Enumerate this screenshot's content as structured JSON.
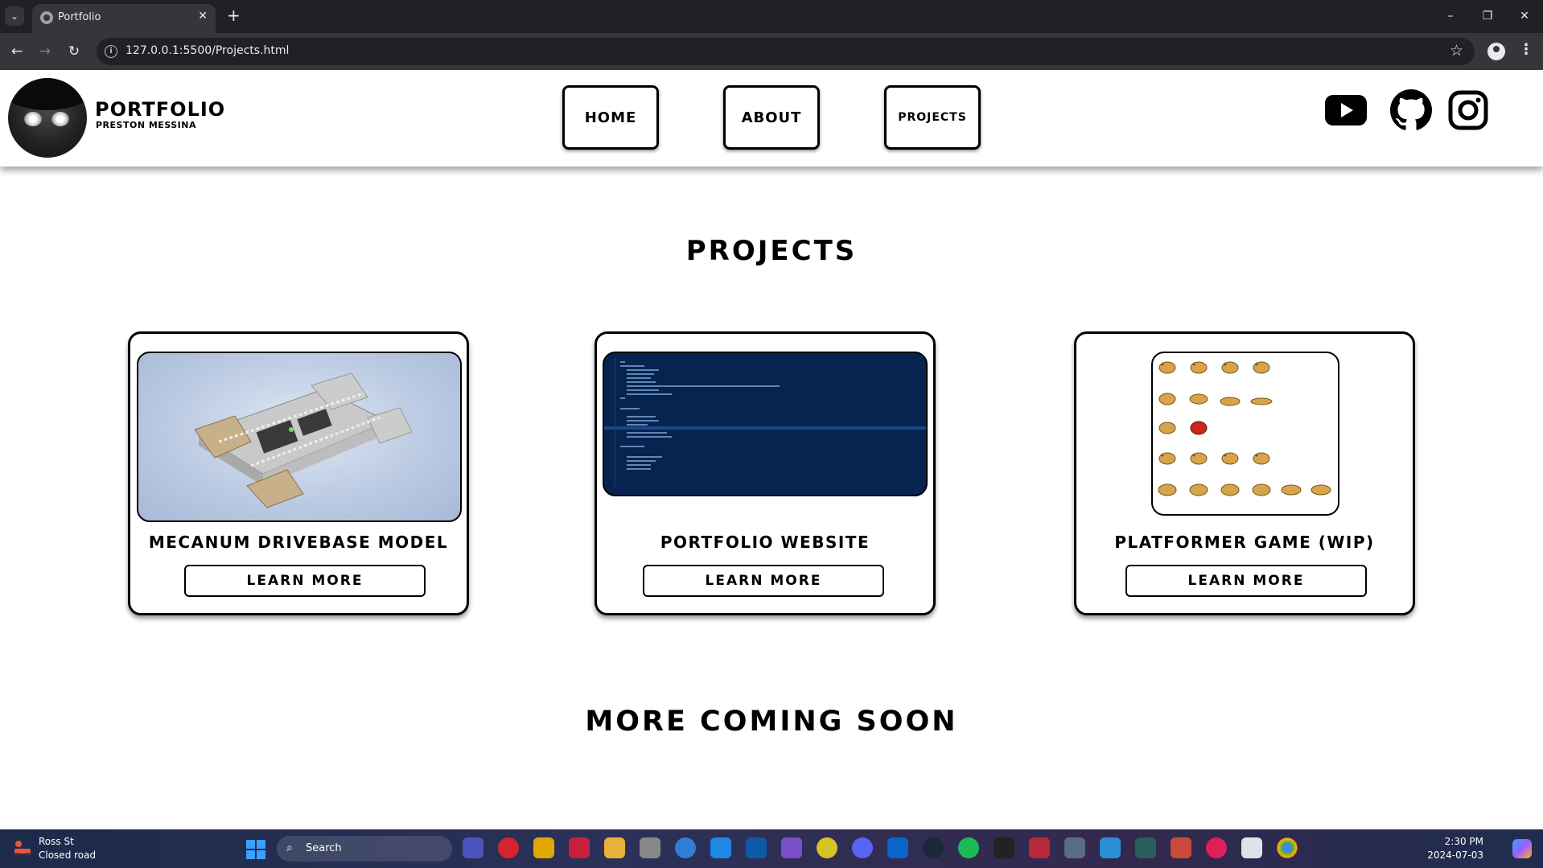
{
  "browser": {
    "tab_title": "Portfolio",
    "tab_close": "✕",
    "new_tab": "+",
    "url": "127.0.0.1:5500/Projects.html",
    "window_controls": [
      "–",
      "❐",
      "✕"
    ]
  },
  "header": {
    "brand_title": "PORTFOLIO",
    "brand_subtitle": "PRESTON MESSINA",
    "nav": [
      {
        "label": "HOME"
      },
      {
        "label": "ABOUT"
      },
      {
        "label": "PROJECTS"
      }
    ],
    "social": [
      "youtube-icon",
      "github-icon",
      "instagram-icon"
    ]
  },
  "main": {
    "heading": "PROJECTS",
    "projects": [
      {
        "title": "MECANUM DRIVEBASE MODEL",
        "button": "LEARN MORE",
        "image": "cad-model-render"
      },
      {
        "title": "PORTFOLIO WEBSITE",
        "button": "LEARN MORE",
        "image": "code-editor-screenshot"
      },
      {
        "title": "PLATFORMER GAME (WIP)",
        "button": "LEARN MORE",
        "image": "sprite-sheet"
      }
    ],
    "footer_heading": "MORE COMING SOON"
  },
  "taskbar": {
    "weather_location": "Ross St",
    "weather_condition": "Closed road",
    "search_placeholder": "Search",
    "time": "2:30 PM",
    "date": "2024-07-03"
  },
  "colors": {
    "accent_blue": "#3aa0ff",
    "code_bg": "#06244f",
    "cad_bg": "#b9c9e2"
  }
}
